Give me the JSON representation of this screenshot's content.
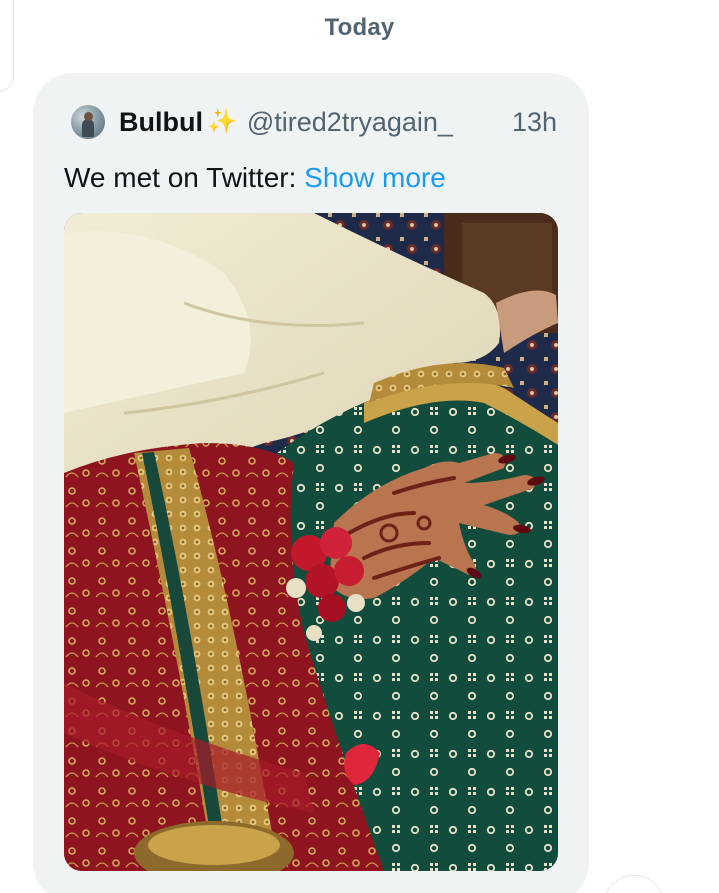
{
  "conversation": {
    "date_divider": "Today"
  },
  "tweet": {
    "author": {
      "display_name": "Bulbul",
      "badge_icon": "sparkle-icon",
      "handle": "@tired2tryagain_",
      "avatar_icon": "avatar"
    },
    "timestamp": "13h",
    "text": "We met on Twitter:",
    "show_more_label": "Show more",
    "media": {
      "type": "photo",
      "colors": {
        "cream": "#efe9cf",
        "green": "#124c3d",
        "red": "#8e1420",
        "gold": "#c9a24a",
        "henna": "#6e2119",
        "rose": "#c3182c"
      }
    }
  },
  "colors": {
    "bubble_bg": "#eff3f4",
    "link": "#1d9bf0",
    "secondary_text": "#536471",
    "primary_text": "#0f1419"
  }
}
